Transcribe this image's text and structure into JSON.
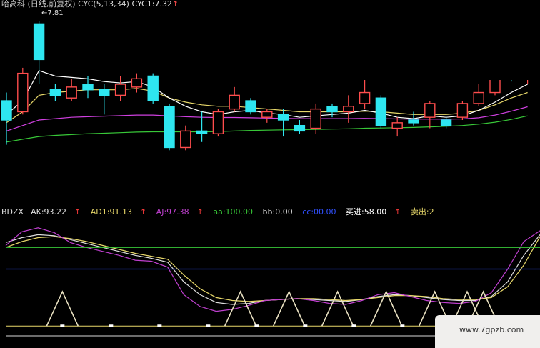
{
  "header": {
    "stock": "哈高科",
    "mode": "(日线,前复权)",
    "cyc_label": "CYC(5,13,34)",
    "cyc1_label": "CYC1:7.32",
    "cyc1_arrow": "↑",
    "high_marker": "←7.81"
  },
  "indicator": {
    "name": "BDZX",
    "ak": "AK:93.22",
    "ad1": "AD1:91.13",
    "aj": "AJ:97.38",
    "aa": "aa:100.00",
    "bb": "bb:0.00",
    "cc": "cc:00.00",
    "buy": "买进:58.00",
    "sell": "卖出:2",
    "arrow": "↑"
  },
  "watermark": {
    "text": "www.7gpzb.com"
  },
  "colors": {
    "up": "#ff4d4d",
    "down": "#2ee6f0",
    "ma_white": "#ffffff",
    "ma_yellow": "#e8d86a",
    "ma_magenta": "#d040e0",
    "ma_green": "#38c838",
    "ak_color": "#e0e0e0",
    "ad1_color": "#e8d86a",
    "aj_color": "#c040d0",
    "aa_color": "#38c838",
    "cc_color": "#3050ff",
    "buy_color": "#ffffff",
    "sell_color": "#e8d86a"
  },
  "chart_data": [
    {
      "type": "candlestick",
      "title": "",
      "price_range": [
        3.0,
        8.2
      ],
      "max_price_label": 7.81,
      "candles": [
        {
          "o": 5.0,
          "c": 4.3,
          "h": 5.3,
          "l": 3.4
        },
        {
          "o": 4.6,
          "c": 6.0,
          "h": 6.2,
          "l": 4.5
        },
        {
          "o": 7.8,
          "c": 6.5,
          "h": 7.9,
          "l": 5.6
        },
        {
          "o": 5.4,
          "c": 5.2,
          "h": 5.6,
          "l": 5.0
        },
        {
          "o": 5.1,
          "c": 5.5,
          "h": 5.8,
          "l": 5.0
        },
        {
          "o": 5.6,
          "c": 5.4,
          "h": 5.9,
          "l": 5.1
        },
        {
          "o": 5.4,
          "c": 5.2,
          "h": 5.6,
          "l": 4.5
        },
        {
          "o": 5.2,
          "c": 5.6,
          "h": 5.9,
          "l": 5.0
        },
        {
          "o": 5.5,
          "c": 5.8,
          "h": 6.0,
          "l": 5.3
        },
        {
          "o": 5.9,
          "c": 5.0,
          "h": 6.0,
          "l": 4.9
        },
        {
          "o": 4.8,
          "c": 3.3,
          "h": 4.9,
          "l": 3.2
        },
        {
          "o": 3.3,
          "c": 3.9,
          "h": 4.1,
          "l": 3.2
        },
        {
          "o": 3.9,
          "c": 3.8,
          "h": 4.6,
          "l": 3.5
        },
        {
          "o": 3.8,
          "c": 4.6,
          "h": 4.7,
          "l": 3.7
        },
        {
          "o": 4.7,
          "c": 5.2,
          "h": 5.5,
          "l": 4.6
        },
        {
          "o": 5.0,
          "c": 4.6,
          "h": 5.1,
          "l": 4.5
        },
        {
          "o": 4.4,
          "c": 4.6,
          "h": 4.7,
          "l": 4.2
        },
        {
          "o": 4.5,
          "c": 4.3,
          "h": 4.7,
          "l": 3.7
        },
        {
          "o": 4.1,
          "c": 3.9,
          "h": 4.3,
          "l": 3.8
        },
        {
          "o": 4.0,
          "c": 4.7,
          "h": 4.9,
          "l": 3.8
        },
        {
          "o": 4.8,
          "c": 4.6,
          "h": 4.9,
          "l": 4.4
        },
        {
          "o": 4.6,
          "c": 4.8,
          "h": 5.2,
          "l": 4.2
        },
        {
          "o": 4.9,
          "c": 5.3,
          "h": 5.8,
          "l": 4.7
        },
        {
          "o": 5.1,
          "c": 4.1,
          "h": 5.2,
          "l": 4.0
        },
        {
          "o": 4.0,
          "c": 4.2,
          "h": 4.4,
          "l": 3.7
        },
        {
          "o": 4.3,
          "c": 4.2,
          "h": 4.6,
          "l": 4.1
        },
        {
          "o": 4.4,
          "c": 4.9,
          "h": 5.0,
          "l": 4.0
        },
        {
          "o": 4.3,
          "c": 4.1,
          "h": 4.4,
          "l": 4.0
        },
        {
          "o": 4.4,
          "c": 4.9,
          "h": 5.0,
          "l": 4.3
        },
        {
          "o": 4.9,
          "c": 5.3,
          "h": 5.6,
          "l": 4.8
        },
        {
          "o": 5.3,
          "c": 5.8,
          "h": 5.9,
          "l": 5.2
        },
        {
          "o": 5.9,
          "c": 5.8,
          "h": 6.0,
          "l": 5.7
        },
        {
          "o": 5.8,
          "c": 5.9,
          "h": 6.0,
          "l": 5.6
        }
      ],
      "ma_white": [
        4.5,
        5.0,
        6.1,
        5.9,
        5.85,
        5.8,
        5.7,
        5.65,
        5.7,
        5.5,
        5.1,
        4.8,
        4.6,
        4.5,
        4.6,
        4.65,
        4.55,
        4.5,
        4.4,
        4.45,
        4.5,
        4.55,
        4.65,
        4.55,
        4.4,
        4.35,
        4.45,
        4.4,
        4.45,
        4.65,
        4.95,
        5.3,
        5.6
      ],
      "ma_yellow": [
        4.2,
        4.6,
        5.2,
        5.3,
        5.35,
        5.4,
        5.4,
        5.4,
        5.45,
        5.35,
        5.1,
        4.95,
        4.85,
        4.8,
        4.8,
        4.75,
        4.7,
        4.65,
        4.6,
        4.6,
        4.6,
        4.6,
        4.62,
        4.6,
        4.55,
        4.5,
        4.5,
        4.5,
        4.55,
        4.65,
        4.85,
        5.1,
        5.3
      ],
      "ma_magenta": [
        3.9,
        4.1,
        4.3,
        4.35,
        4.4,
        4.42,
        4.44,
        4.46,
        4.48,
        4.48,
        4.45,
        4.42,
        4.4,
        4.39,
        4.39,
        4.38,
        4.37,
        4.36,
        4.35,
        4.35,
        4.35,
        4.35,
        4.36,
        4.35,
        4.34,
        4.33,
        4.33,
        4.33,
        4.34,
        4.38,
        4.48,
        4.62,
        4.78
      ],
      "ma_green": [
        3.5,
        3.6,
        3.7,
        3.74,
        3.77,
        3.8,
        3.82,
        3.84,
        3.86,
        3.87,
        3.87,
        3.87,
        3.87,
        3.88,
        3.9,
        3.92,
        3.93,
        3.94,
        3.95,
        3.96,
        3.97,
        3.98,
        4.0,
        4.01,
        4.02,
        4.03,
        4.05,
        4.07,
        4.1,
        4.15,
        4.22,
        4.32,
        4.45
      ]
    },
    {
      "type": "line",
      "title": "BDZX",
      "y_range": [
        -10,
        110
      ],
      "x": [
        0,
        1,
        2,
        3,
        4,
        5,
        6,
        7,
        8,
        9,
        10,
        11,
        12,
        13,
        14,
        15,
        16,
        17,
        18,
        19,
        20,
        21,
        22,
        23,
        24,
        25,
        26,
        27,
        28,
        29,
        30,
        31,
        32,
        33
      ],
      "series": [
        {
          "name": "AK",
          "values": [
            85,
            90,
            93,
            92,
            88,
            84,
            80,
            76,
            72,
            69,
            65,
            45,
            32,
            24,
            22,
            23,
            26,
            27,
            28,
            27,
            26,
            25,
            27,
            30,
            32,
            31,
            29,
            27,
            26,
            26,
            30,
            45,
            72,
            93
          ]
        },
        {
          "name": "AD1",
          "values": [
            80,
            86,
            90,
            91,
            89,
            86,
            82,
            78,
            74,
            71,
            68,
            52,
            38,
            29,
            26,
            25,
            26,
            27,
            28,
            28,
            27,
            26,
            27,
            29,
            31,
            31,
            30,
            28,
            27,
            27,
            29,
            40,
            62,
            91
          ]
        },
        {
          "name": "AJ",
          "values": [
            82,
            96,
            100,
            95,
            85,
            80,
            76,
            72,
            67,
            66,
            60,
            32,
            20,
            15,
            17,
            21,
            26,
            27,
            28,
            26,
            23,
            22,
            26,
            32,
            34,
            30,
            26,
            24,
            23,
            25,
            34,
            58,
            86,
            97
          ]
        },
        {
          "name": "aa",
          "values": [
            80,
            80,
            80,
            80,
            80,
            80,
            80,
            80,
            80,
            80,
            80,
            80,
            80,
            80,
            80,
            80,
            80,
            80,
            80,
            80,
            80,
            80,
            80,
            80,
            80,
            80,
            80,
            80,
            80,
            80,
            80,
            80,
            80,
            80
          ]
        },
        {
          "name": "cc",
          "values": [
            58,
            58,
            58,
            58,
            58,
            58,
            58,
            58,
            58,
            58,
            58,
            58,
            58,
            58,
            58,
            58,
            58,
            58,
            58,
            58,
            58,
            58,
            58,
            58,
            58,
            58,
            58,
            58,
            58,
            58,
            58,
            58,
            58,
            58
          ]
        }
      ],
      "bb_level": 0,
      "sell_level": -10,
      "buy_spikes_x": [
        3.5,
        14.5,
        17.5,
        20.5,
        23.5,
        26.5,
        28.5,
        29.5
      ],
      "buy_spike_value": 35,
      "markers_x": [
        3.5,
        6.5,
        9.5,
        12.5,
        15.5,
        18.5,
        21.5,
        24.5,
        27.5,
        30.5
      ]
    }
  ]
}
